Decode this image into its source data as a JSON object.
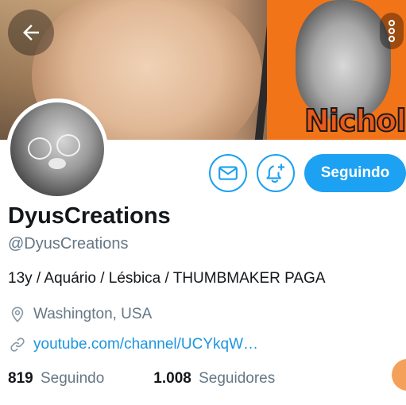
{
  "banner": {
    "text": "Nichols"
  },
  "profile": {
    "display_name": "DyusCreations",
    "handle": "@DyusCreations",
    "bio": "13y / Aquário / Lésbica / THUMBMAKER PAGA",
    "location": "Washington, USA",
    "website": "youtube.com/channel/UCYkqW…"
  },
  "actions": {
    "follow_label": "Seguindo"
  },
  "stats": {
    "following_count": "819",
    "following_label": "Seguindo",
    "followers_count": "1.008",
    "followers_label": "Seguidores"
  },
  "colors": {
    "accent": "#1da1f2",
    "link": "#1b95e0",
    "secondary_text": "#657786",
    "primary_text": "#14171a"
  },
  "icons": [
    "back-arrow-icon",
    "more-vertical-icon",
    "mail-icon",
    "bell-add-icon",
    "location-pin-icon",
    "link-icon"
  ]
}
